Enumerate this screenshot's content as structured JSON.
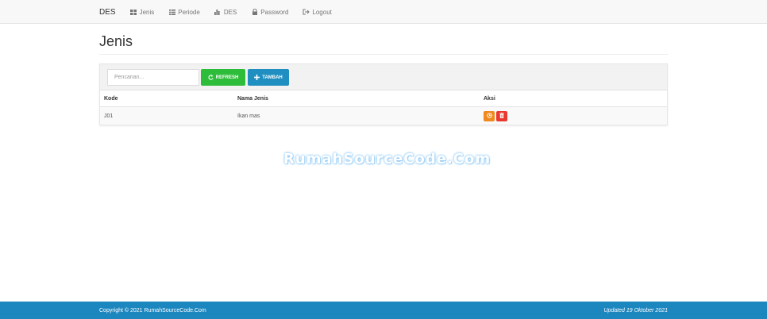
{
  "navbar": {
    "brand": "DES",
    "items": [
      {
        "label": "Jenis",
        "icon": "th-large-icon"
      },
      {
        "label": "Periode",
        "icon": "list-icon"
      },
      {
        "label": "DES",
        "icon": "bar-chart-icon"
      },
      {
        "label": "Password",
        "icon": "lock-icon"
      },
      {
        "label": "Logout",
        "icon": "logout-icon"
      }
    ]
  },
  "page": {
    "title": "Jenis"
  },
  "toolbar": {
    "search_placeholder": "Pencarian...",
    "refresh_label": "REFRESH",
    "add_label": "TAMBAH",
    "refresh_color": "#2ebd3a",
    "add_color": "#1f8fc1"
  },
  "table": {
    "headers": [
      "Kode",
      "Nama Jenis",
      "Aksi"
    ],
    "rows": [
      {
        "kode": "J01",
        "nama": "Ikan mas",
        "actions": [
          "edit-icon",
          "trash-icon"
        ]
      }
    ]
  },
  "watermark": "RumahSourceCode.Com",
  "footer": {
    "left": "Copyright © 2021 RumahSourceCode.Com",
    "right": "Updated 19 Oktober 2021",
    "color": "#1c87bf"
  }
}
